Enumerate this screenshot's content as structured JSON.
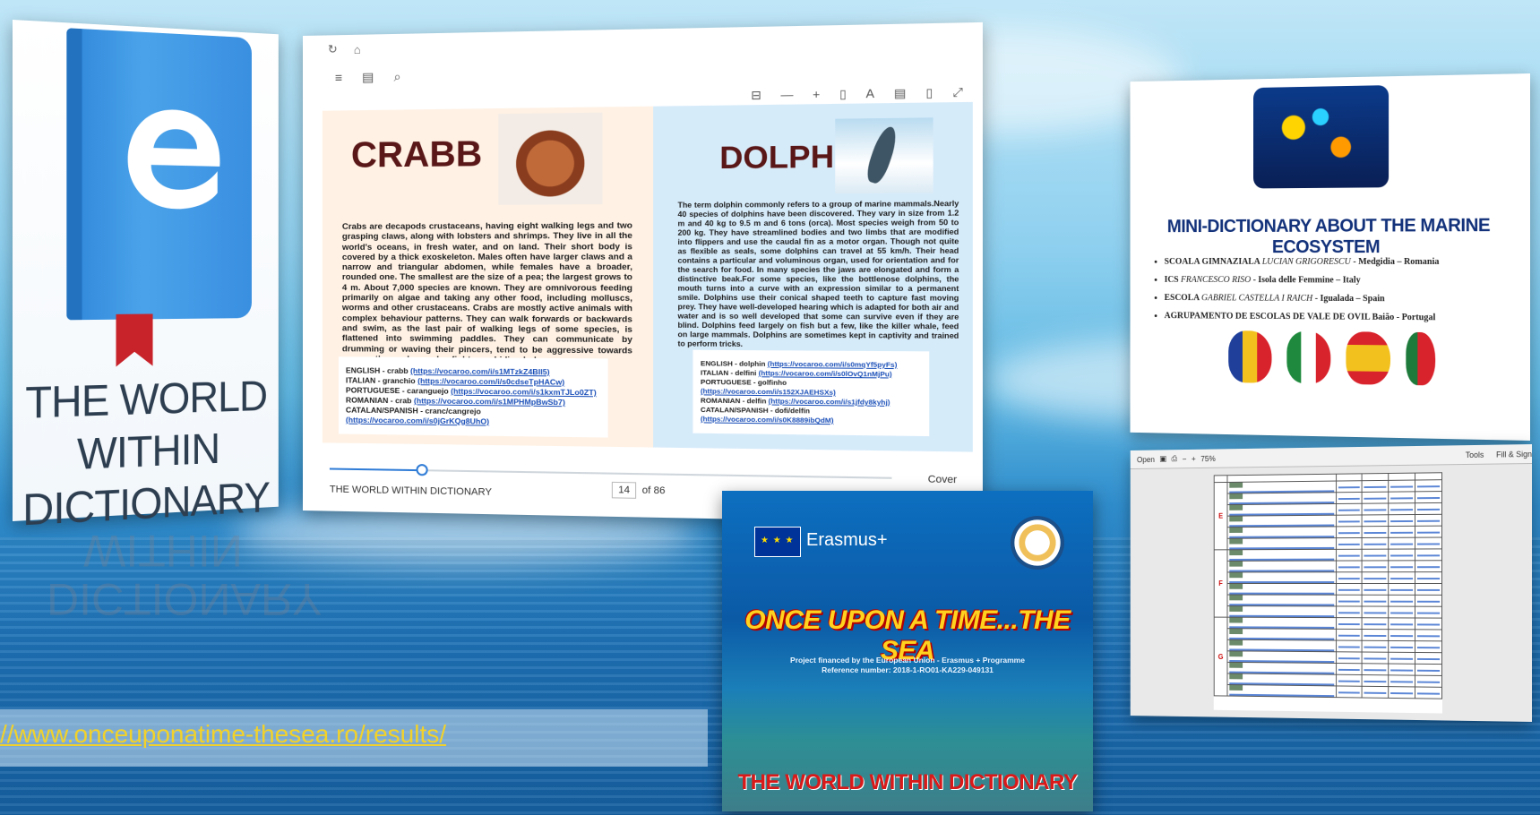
{
  "book": {
    "title_lines": [
      "THE WORLD",
      "WITHIN",
      "DICTIONARY"
    ],
    "reflection_lines": [
      "DICTIONARY",
      "WITHIN"
    ]
  },
  "reader": {
    "top_icons": [
      "↻",
      "⌂"
    ],
    "toolbar_icons": [
      "≡",
      "▤",
      "⌕"
    ],
    "right_tools": [
      "⊟",
      "—",
      "+",
      "▯",
      "A",
      "▤",
      "▯",
      "⤢"
    ],
    "left_page": {
      "heading": "CRABB",
      "text": "Crabs are decapods crustaceans, having eight walking legs and two grasping claws, along with lobsters and shrimps. They live in all the world's oceans, in fresh water, and on land. Their short body is covered by a thick exoskeleton. Males often have larger claws and a narrow and triangular abdomen, while females have a broader, rounded one. The smallest are the size of a pea; the largest grows to 4 m. About 7,000 species are known. They are omnivorous feeding primarily on algae and taking any other food, including molluscs, worms and other crustaceans. Crabs are mostly active animals with complex behaviour patterns. They can walk forwards or backwards and swim, as the last pair of walking legs of some species, is flattened into swimming paddles. They can communicate by drumming or waving their pincers, tend to be aggressive towards one another and may also fight over hiding holes.",
      "links": [
        {
          "lang": "ENGLISH - crabb",
          "url": "(https://vocaroo.com/i/s1MTzkZ4BII5)"
        },
        {
          "lang": "ITALIAN - granchio",
          "url": "(https://vocaroo.com/i/s0cdseTpHACw)"
        },
        {
          "lang": "PORTUGUESE - caranguejo",
          "url": "(https://vocaroo.com/i/s1kxmTJLo0ZT)"
        },
        {
          "lang": "ROMANIAN - crab",
          "url": "(https://vocaroo.com/i/s1MPHMpBwSb7)"
        },
        {
          "lang": "CATALAN/SPANISH - cranc/cangrejo",
          "url": "(https://vocaroo.com/i/s0jGrKQg8UhO)"
        }
      ]
    },
    "right_page": {
      "heading": "DOLPHIN",
      "text": "The term dolphin commonly refers to a group of marine mammals.Nearly 40 species of dolphins have been discovered. They vary in size from 1.2 m and 40 kg to 9.5 m and 6 tons (orca). Most species weigh from 50 to 200 kg. They have streamlined bodies and two limbs that are modified into flippers and use the caudal fin as a motor organ. Though not quite as flexible as seals, some dolphins can travel at 55 km/h. Their head contains a particular and voluminous organ, used for orientation and for the search for food. In many species the jaws are elongated and form a distinctive beak.For some species, like the bottlenose dolphins, the mouth turns into a curve with an expression similar to a permanent smile. Dolphins use their conical shaped teeth to capture fast moving prey. They have well-developed hearing which is adapted for both air and water and is so well developed that some can survive even if they are blind. Dolphins feed largely on fish but a few, like the killer whale, feed on large mammals. Dolphins are sometimes kept in captivity and trained to perform tricks.",
      "links": [
        {
          "lang": "ENGLISH - dolphin",
          "url": "(https://vocaroo.com/i/s0mqYf5pyFs)"
        },
        {
          "lang": "ITALIAN - delfini",
          "url": "(https://vocaroo.com/i/s0lOvQ1nMjPu)"
        },
        {
          "lang": "PORTUGUESE - golfinho",
          "url": "(https://vocaroo.com/i/s152XJAEHSXs)"
        },
        {
          "lang": "ROMANIAN - delfin",
          "url": "(https://vocaroo.com/i/s1jfdy8kyhj)"
        },
        {
          "lang": "CATALAN/SPANISH - dofi/delfín",
          "url": "(https://vocaroo.com/i/s0K8889ibQdM)"
        }
      ]
    },
    "bottom": {
      "book_name": "THE WORLD WITHIN DICTIONARY",
      "page_current": "14",
      "page_total": "of 86",
      "progress": 0.17,
      "cover_label": "Cover"
    }
  },
  "mini": {
    "title": "MINI-DICTIONARY ABOUT THE MARINE ECOSYSTEM",
    "schools": [
      {
        "prefix": "SCOALA GIMNAZIALA",
        "name": "LUCIAN GRIGORESCU",
        "rest": "- Medgidia – Romania"
      },
      {
        "prefix": "ICS",
        "name": "FRANCESCO RISO",
        "rest": "- Isola delle Femmine – Italy"
      },
      {
        "prefix": "ESCOLA",
        "name": "GABRIEL CASTELLA I RAICH",
        "rest": "- Igualada – Spain"
      },
      {
        "prefix": "AGRUPAMENTO DE ESCOLAS DE VALE DE OVIL Baião",
        "name": "",
        "rest": "- Portugal"
      }
    ],
    "flag_colors": [
      "#1f3f9a",
      "#f3c11e",
      "#d9232c",
      "#1f8a3d",
      "#ffffff",
      "#d9232c",
      "#d9232c",
      "#f3c11e",
      "#1d7a3a",
      "#d9232c"
    ]
  },
  "pdf": {
    "toolbar": {
      "open": "Open",
      "zoom": "75%",
      "tools": "Tools",
      "fill": "Fill & Sign"
    },
    "letters": [
      "E",
      "F",
      "G"
    ]
  },
  "erasmus": {
    "program": "Erasmus+",
    "title": "ONCE UPON A TIME...THE SEA",
    "sub_line1": "Project financed by the European Union - Erasmus + Programme",
    "sub_line2": "Reference number: 2018-1-RO01-KA229-049131",
    "bottom": "THE WORLD WITHIN DICTIONARY"
  },
  "url": "//www.onceuponatime-thesea.ro/results/"
}
